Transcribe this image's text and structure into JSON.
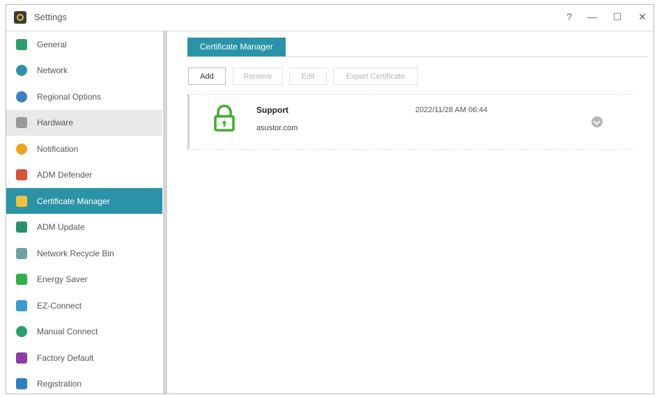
{
  "window": {
    "title": "Settings",
    "help_glyph": "?",
    "minimize_glyph": "—",
    "maximize_glyph": "☐",
    "close_glyph": "✕"
  },
  "sidebar": {
    "items": [
      {
        "label": "General",
        "icon": "general-icon",
        "color": "#2aa06a"
      },
      {
        "label": "Network",
        "icon": "network-icon",
        "color": "#2a93a8"
      },
      {
        "label": "Regional Options",
        "icon": "globe-icon",
        "color": "#3a7fc1"
      },
      {
        "label": "Hardware",
        "icon": "hardware-icon",
        "color": "#9a9a9a"
      },
      {
        "label": "Notification",
        "icon": "notification-icon",
        "color": "#f0a11c"
      },
      {
        "label": "ADM Defender",
        "icon": "defender-icon",
        "color": "#d95336"
      },
      {
        "label": "Certificate Manager",
        "icon": "certificate-icon",
        "color": "#f2c23a"
      },
      {
        "label": "ADM Update",
        "icon": "update-icon",
        "color": "#2a8f6a"
      },
      {
        "label": "Network Recycle Bin",
        "icon": "recycle-bin-icon",
        "color": "#6fa0a6"
      },
      {
        "label": "Energy Saver",
        "icon": "energy-saver-icon",
        "color": "#2fb04a"
      },
      {
        "label": "EZ-Connect",
        "icon": "ez-connect-icon",
        "color": "#3a9bd0"
      },
      {
        "label": "Manual Connect",
        "icon": "manual-connect-icon",
        "color": "#2e9f6b"
      },
      {
        "label": "Factory Default",
        "icon": "factory-default-icon",
        "color": "#8b3da5"
      },
      {
        "label": "Registration",
        "icon": "registration-icon",
        "color": "#2f7fbe"
      }
    ],
    "active_index": 6,
    "hover_index": 3
  },
  "main": {
    "tab_label": "Certificate Manager",
    "buttons": {
      "add": "Add",
      "remove": "Remove",
      "edit": "Edit",
      "export": "Export Certificate"
    },
    "certificate": {
      "name": "Support",
      "domain": "asustor.com",
      "date": "2022/11/28 AM 06:44"
    },
    "colors": {
      "accent": "#2a93a8",
      "lock": "#3dae2b"
    }
  }
}
